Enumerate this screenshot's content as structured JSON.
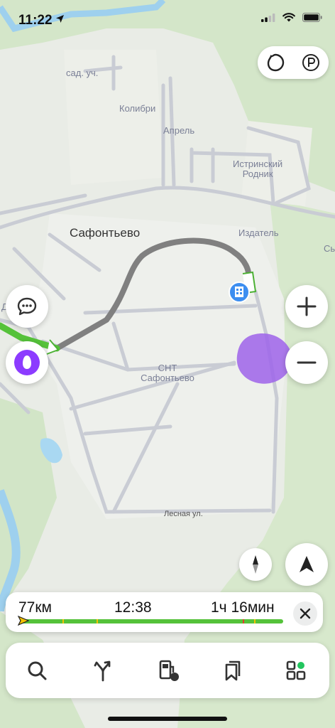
{
  "status_bar": {
    "time": "11:22"
  },
  "map": {
    "labels": {
      "sad_uch": "сад. уч.",
      "kolibri": "Колибри",
      "aprel": "Апрель",
      "istrinsky_line1": "Истринский",
      "istrinsky_line2": "Родник",
      "safontevo": "Сафонтьево",
      "izdatel": "Издатель",
      "edge_right": "Сь",
      "snt_line1": "СНТ",
      "snt_line2": "Сафонтьево",
      "lesnaya": "Лесная ул.",
      "edge_left": "Д"
    }
  },
  "route": {
    "distance": "77км",
    "arrival_time": "12:38",
    "duration": "1ч 16мин",
    "progress_fraction": 0.02
  },
  "colors": {
    "route_active": "#55c23a",
    "route_passed": "#8a8a8a",
    "alice_purple": "#8c3bff",
    "poi_blue": "#3d8ef0",
    "green_dot": "#22c55e"
  },
  "icons": {
    "layers": "layers-icon",
    "parking": "parking-icon",
    "chat": "chat-icon",
    "alice": "alice-icon",
    "zoom_in": "plus-icon",
    "zoom_out": "minus-icon",
    "compass": "compass-icon",
    "navigate": "navigation-arrow-icon",
    "close": "close-icon",
    "search": "search-icon",
    "routes": "fork-arrows-icon",
    "fuel": "fuel-icon",
    "bookmarks": "bookmarks-icon",
    "services": "services-grid-icon"
  }
}
